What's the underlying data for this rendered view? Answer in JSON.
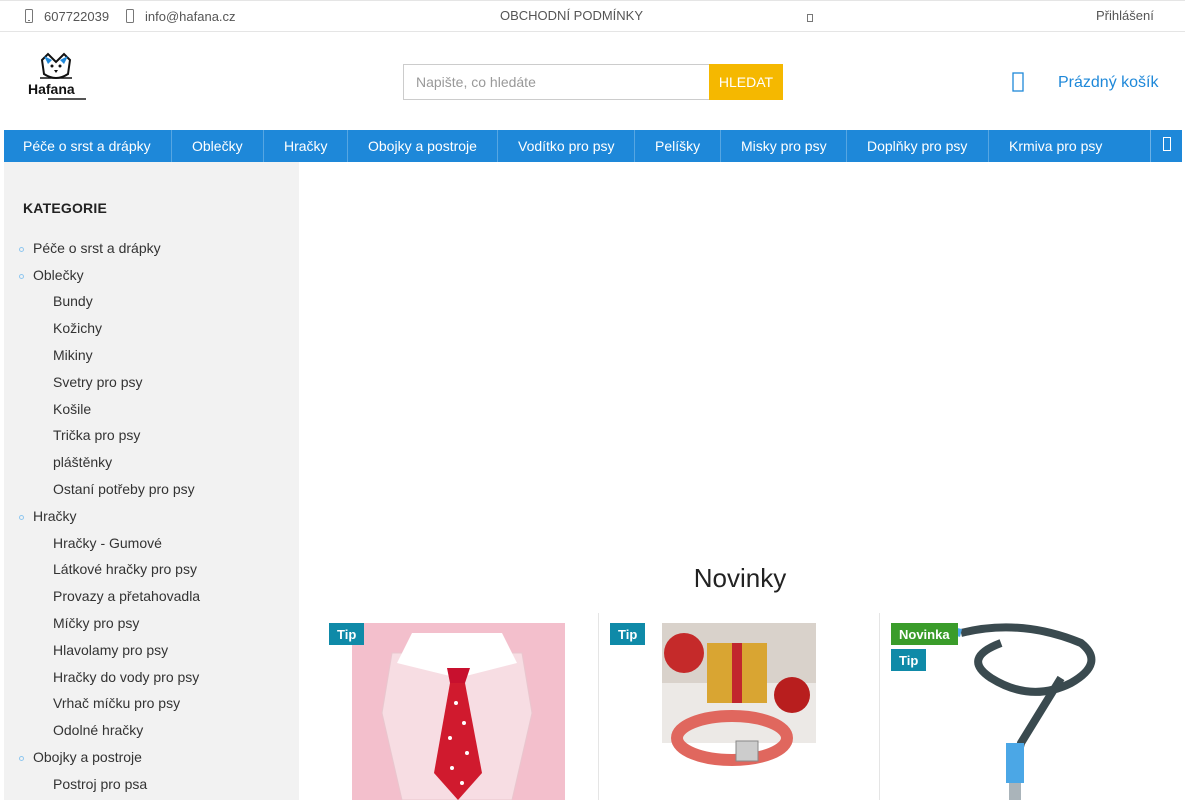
{
  "topbar": {
    "phone": "607722039",
    "email": "info@hafana.cz",
    "terms": "OBCHODNÍ PODMÍNKY",
    "login": "Přihlášení"
  },
  "brand": {
    "name": "Hafana"
  },
  "search": {
    "placeholder": "Napište, co hledáte",
    "button": "HLEDAT"
  },
  "cart": {
    "label": "Prázdný košík"
  },
  "nav": {
    "items": [
      "Péče o srst a drápky",
      "Oblečky",
      "Hračky",
      "Obojky a postroje",
      "Vodítko pro psy",
      "Pelíšky",
      "Misky pro psy",
      "Doplňky pro psy",
      "Krmiva pro psy"
    ]
  },
  "sidebar": {
    "heading": "KATEGORIE",
    "categories": [
      "Péče o srst a drápky",
      "Oblečky",
      "Bundy",
      "Kožichy",
      "Mikiny",
      "Svetry pro psy",
      "Košile",
      "Trička pro psy",
      "pláštěnky",
      "Ostaní potřeby pro psy",
      "Hračky",
      "Hračky - Gumové",
      "Látkové hračky pro psy",
      "Provazy a přetahovadla",
      "Míčky pro psy",
      "Hlavolamy pro psy",
      "Hračky do vody pro psy",
      "Vrhač míčku pro psy",
      "Odolné hračky",
      "Obojky a postroje",
      "Postroj pro psa"
    ]
  },
  "main": {
    "section_title": "Novinky",
    "products": [
      {
        "badges": [
          "Tip"
        ]
      },
      {
        "badges": [
          "Tip"
        ]
      },
      {
        "badges": [
          "Novinka",
          "Tip"
        ]
      }
    ]
  },
  "colors": {
    "accent": "#1e88d9",
    "search_button": "#f5b800",
    "tip_badge": "#0f8aa8",
    "new_badge": "#3a9c2a"
  }
}
